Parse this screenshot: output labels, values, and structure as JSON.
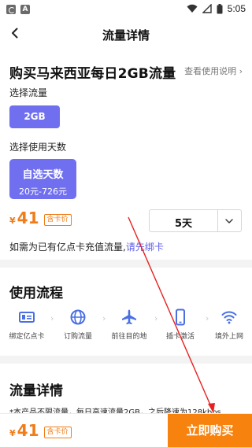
{
  "status_bar": {
    "time": "5:05"
  },
  "nav": {
    "title": "流量详情"
  },
  "product": {
    "title": "购买马来西亚每日2GB流量",
    "usage_link": "查看使用说明 ›",
    "select_data_label": "选择流量",
    "data_option": "2GB",
    "select_days_label": "选择使用天数",
    "days_option_title": "自选天数",
    "days_option_range": "20元-726元",
    "currency": "¥",
    "price": "41",
    "price_tag": "含卡价",
    "days_value": "5天",
    "recharge_text": "如需为已有亿点卡充值流量,",
    "recharge_link": "请先绑卡"
  },
  "flow": {
    "title": "使用流程",
    "steps": [
      {
        "label": "绑定亿点卡",
        "icon": "card-icon"
      },
      {
        "label": "订购流量",
        "icon": "globe-icon"
      },
      {
        "label": "前往目的地",
        "icon": "airplane-icon"
      },
      {
        "label": "插卡激活",
        "icon": "phone-icon"
      },
      {
        "label": "境外上网",
        "icon": "wifi-icon"
      }
    ]
  },
  "details": {
    "title": "流量详情",
    "text": "*本产品不限流量，每日高速流量2GB，之后降速为128kbps"
  },
  "bottom": {
    "currency": "¥",
    "price": "41",
    "price_tag": "含卡价",
    "buy_label": "立即购买"
  },
  "colors": {
    "accent": "#6f6ff0",
    "price": "#f07d1a",
    "buy_button": "#f7830e",
    "annotation": "#e8211f"
  }
}
